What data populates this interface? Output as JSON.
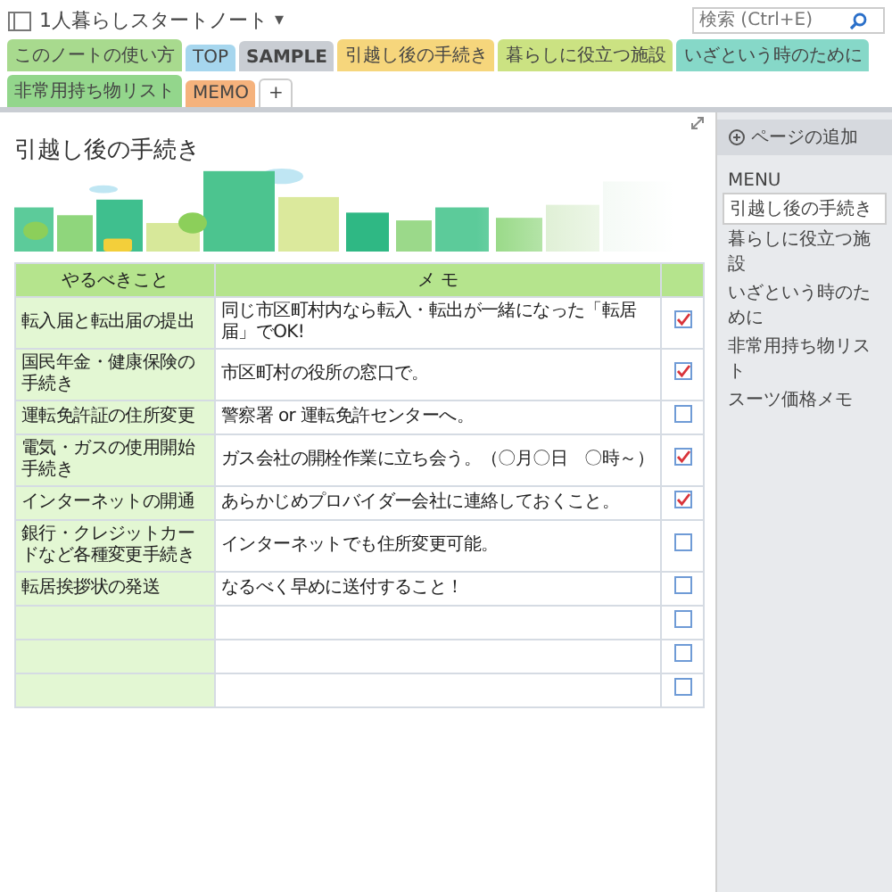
{
  "notebook": {
    "title": "1人暮らしスタートノート",
    "caret": "▾"
  },
  "tabs": [
    {
      "label": "このノートの使い方",
      "color": "#a8da8e",
      "selected": false
    },
    {
      "label": "TOP",
      "color": "#a6d6ee",
      "selected": false
    },
    {
      "label": "SAMPLE",
      "color": "#c9cdd3",
      "selected": true
    },
    {
      "label": "引越し後の手続き",
      "color": "#f6d67c",
      "selected": false
    },
    {
      "label": "暮らしに役立つ施設",
      "color": "#cbe282",
      "selected": false
    },
    {
      "label": "いざという時のために",
      "color": "#86d8c8",
      "selected": false
    },
    {
      "label": "非常用持ち物リスト",
      "color": "#93d68c",
      "selected": false
    },
    {
      "label": "MEMO",
      "color": "#f5b27c",
      "selected": false
    }
  ],
  "add_tab": "+",
  "search": {
    "placeholder": "検索 (Ctrl+E)"
  },
  "page": {
    "title": "引越し後の手続き"
  },
  "table": {
    "columns": [
      "やるべきこと",
      "メ モ"
    ],
    "rows": [
      {
        "task": "転入届と転出届の提出",
        "memo": "同じ市区町村内なら転入・転出が一緒になった「転居届」でOK!",
        "checked": true
      },
      {
        "task": "国民年金・健康保険の手続き",
        "memo": "市区町村の役所の窓口で。",
        "checked": true
      },
      {
        "task": "運転免許証の住所変更",
        "memo": "警察署 or 運転免許センターへ。",
        "checked": false
      },
      {
        "task": "電気・ガスの使用開始手続き",
        "memo": "ガス会社の開栓作業に立ち会う。（〇月〇日　〇時～）",
        "checked": true
      },
      {
        "task": "インターネットの開通",
        "memo": "あらかじめプロバイダー会社に連絡しておくこと。",
        "checked": true
      },
      {
        "task": "銀行・クレジットカードなど各種変更手続き",
        "memo": "インターネットでも住所変更可能。",
        "checked": false
      },
      {
        "task": "転居挨拶状の発送",
        "memo": "なるべく早めに送付すること！",
        "checked": false
      },
      {
        "checked": false
      },
      {
        "checked": false
      },
      {
        "checked": false
      }
    ]
  },
  "sidebar": {
    "add_page": "ページの追加",
    "items": [
      {
        "label": "MENU",
        "selected": false
      },
      {
        "label": "引越し後の手続き",
        "selected": true
      },
      {
        "label": "暮らしに役立つ施設",
        "selected": false
      },
      {
        "label": "いざという時のために",
        "selected": false
      },
      {
        "label": "非常用持ち物リスト",
        "selected": false
      },
      {
        "label": "スーツ価格メモ",
        "selected": false
      }
    ]
  }
}
